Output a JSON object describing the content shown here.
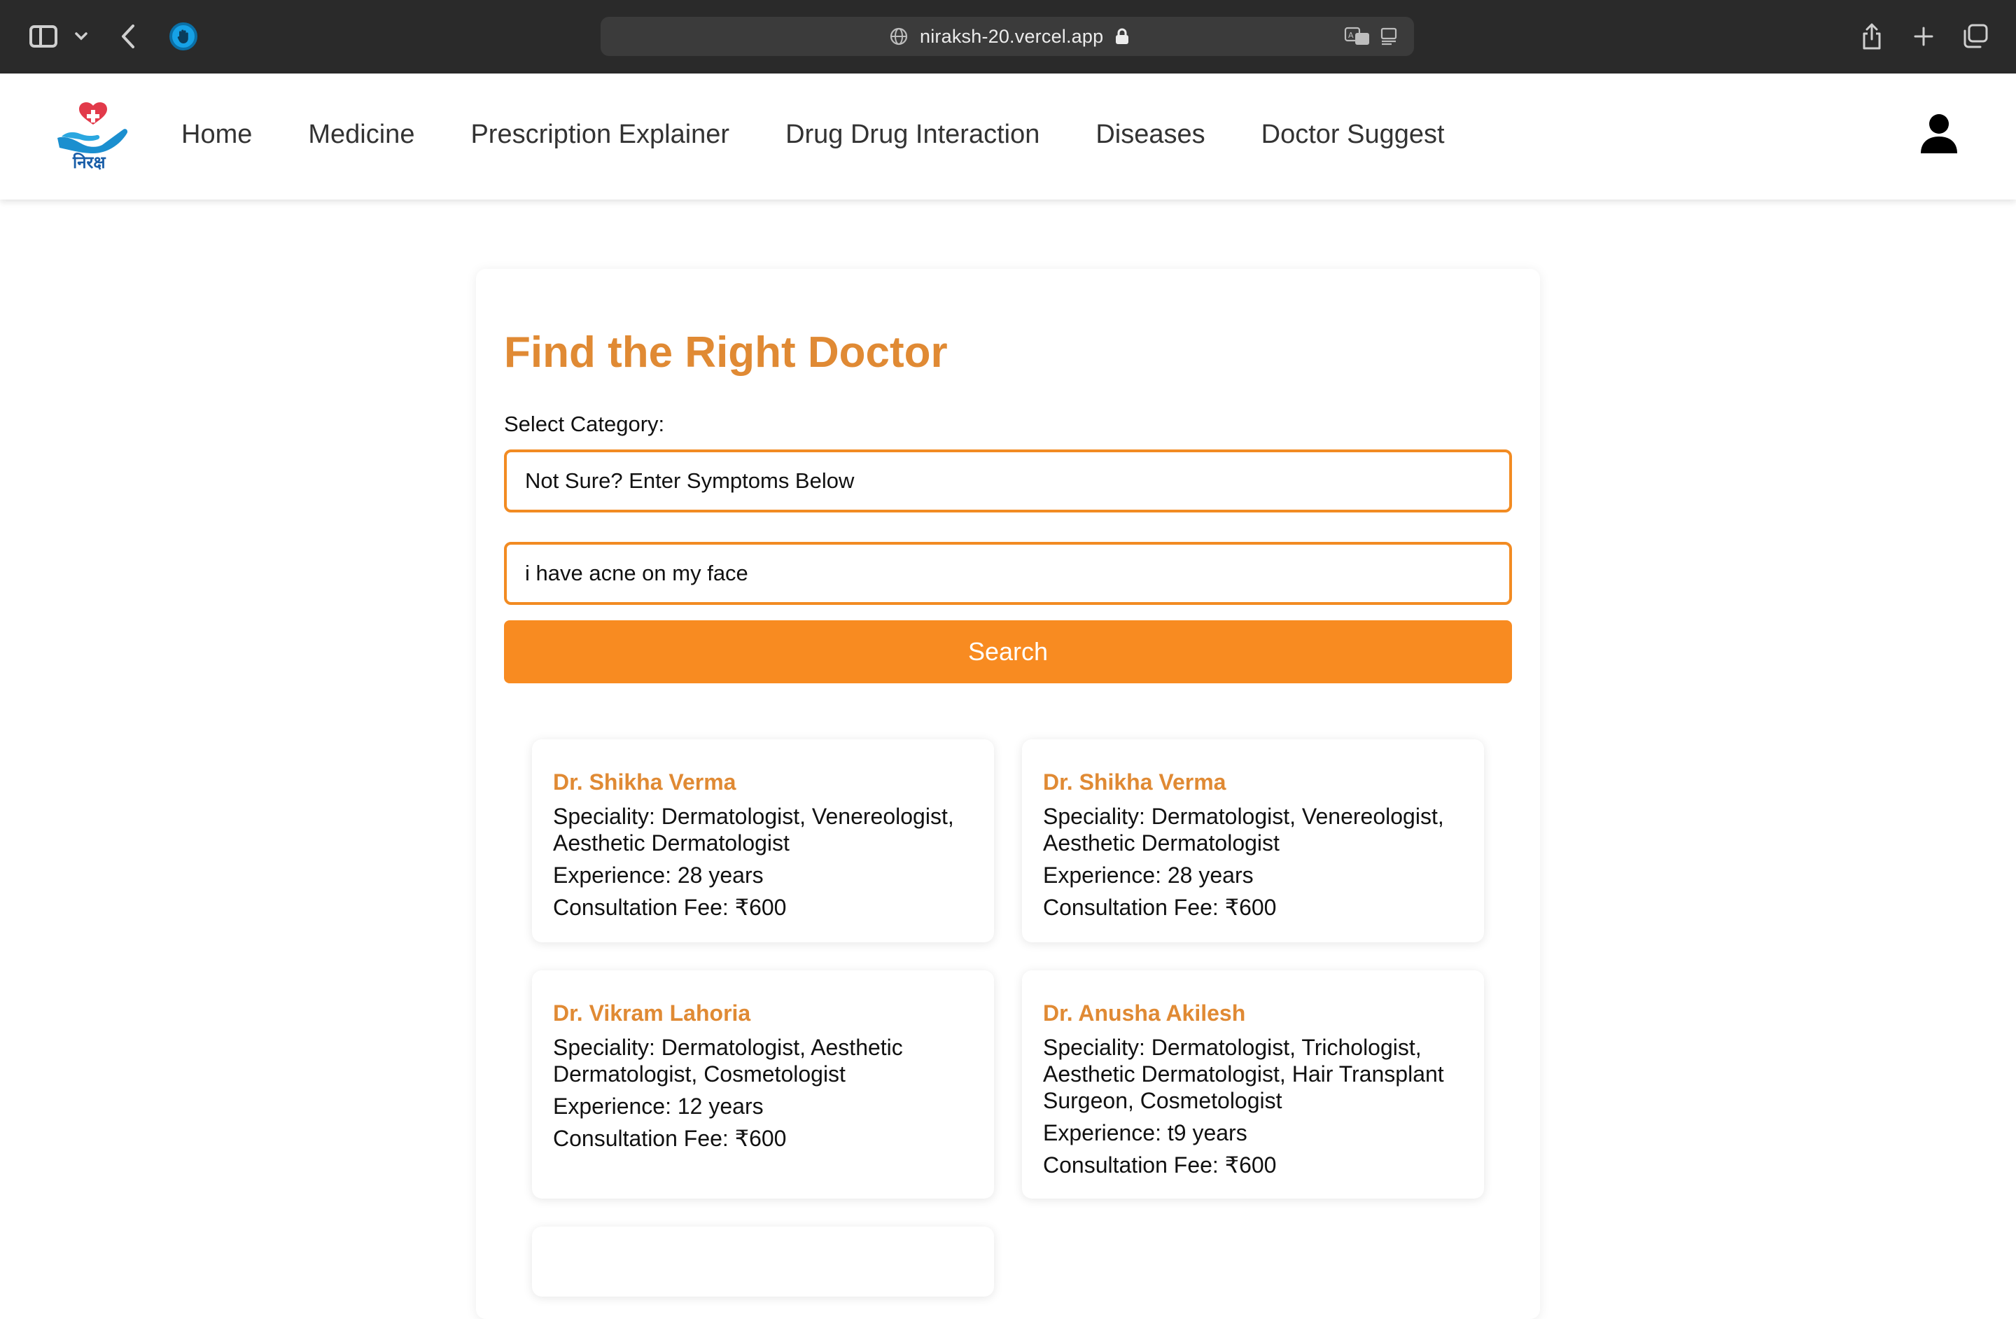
{
  "browser": {
    "url": "niraksh-20.vercel.app"
  },
  "nav": {
    "logo_text": "निरक्ष",
    "links": [
      "Home",
      "Medicine",
      "Prescription Explainer",
      "Drug Drug Interaction",
      "Diseases",
      "Doctor Suggest"
    ]
  },
  "main": {
    "title": "Find the Right Doctor",
    "select_label": "Select Category:",
    "select_value": "Not Sure? Enter Symptoms Below",
    "symptom_value": "i have acne on my face",
    "search_label": "Search"
  },
  "doctors": [
    {
      "name": "Dr. Shikha Verma",
      "speciality": [
        "Speciality: Dermatologist, Venereologist,",
        "Aesthetic Dermatologist"
      ],
      "experience": "Experience: 28 years",
      "fee": "Consultation Fee: ₹600"
    },
    {
      "name": "Dr. Shikha Verma",
      "speciality": [
        "Speciality: Dermatologist, Venereologist,",
        "Aesthetic Dermatologist"
      ],
      "experience": "Experience: 28 years",
      "fee": "Consultation Fee: ₹600"
    },
    {
      "name": "Dr. Vikram Lahoria",
      "speciality": [
        "Speciality: Dermatologist, Aesthetic",
        "Dermatologist, Cosmetologist"
      ],
      "experience": "Experience: 12 years",
      "fee": "Consultation Fee: ₹600"
    },
    {
      "name": "Dr. Anusha Akilesh",
      "speciality": [
        "Speciality: Dermatologist, Trichologist,",
        "Aesthetic Dermatologist, Hair Transplant",
        "Surgeon, Cosmetologist"
      ],
      "experience": "Experience: t9 years",
      "fee": "Consultation Fee: ₹600"
    }
  ]
}
